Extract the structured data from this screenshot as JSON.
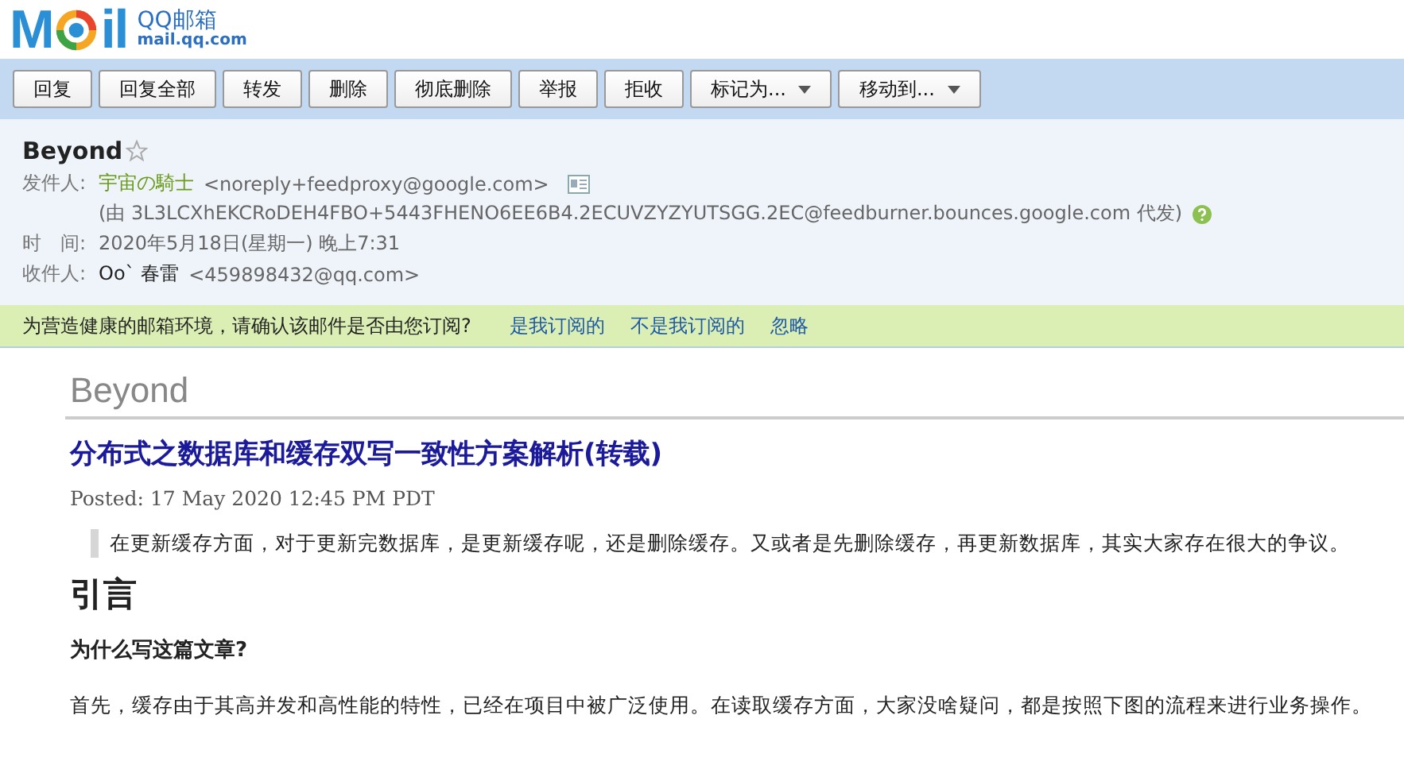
{
  "logo": {
    "left": "M",
    "right": "il",
    "product": "QQ邮箱",
    "domain": "mail.qq.com"
  },
  "toolbar": [
    {
      "label": "回复",
      "kind": "plain"
    },
    {
      "label": "回复全部",
      "kind": "plain"
    },
    {
      "label": "转发",
      "kind": "plain"
    },
    {
      "label": "删除",
      "kind": "plain"
    },
    {
      "label": "彻底删除",
      "kind": "plain"
    },
    {
      "label": "举报",
      "kind": "plain"
    },
    {
      "label": "拒收",
      "kind": "plain"
    },
    {
      "label": "标记为...",
      "kind": "dropdown"
    },
    {
      "label": "移动到...",
      "kind": "dropdown"
    }
  ],
  "mail": {
    "subject": "Beyond",
    "starred": false,
    "from_label": "发件人:",
    "from_name": "宇宙の騎士",
    "from_address": "<noreply+feedproxy@google.com>",
    "via": "(由 3L3LCXhEKCRoDEH4FBO+5443FHENO6EE6B4.2ECUVZYZYUTSGG.2EC@feedburner.bounces.google.com 代发)",
    "time_label": "时　间:",
    "time": "2020年5月18日(星期一) 晚上7:31",
    "to_label": "收件人:",
    "to_name": "Oo`  春雷",
    "to_address": "<459898432@qq.com>"
  },
  "notice": {
    "text": "为营造健康的邮箱环境，请确认该邮件是否由您订阅?",
    "links": [
      "是我订阅的",
      "不是我订阅的",
      "忽略"
    ]
  },
  "body": {
    "feed_title": "Beyond",
    "article_title": "分布式之数据库和缓存双写一致性方案解析(转载)",
    "posted": "Posted: 17 May 2020 12:45 PM PDT",
    "quote": "在更新缓存方面，对于更新完数据库，是更新缓存呢，还是删除缓存。又或者是先删除缓存，再更新数据库，其实大家存在很大的争议。",
    "heading": "引言",
    "subheading": "为什么写这篇文章?",
    "paragraph": "首先，缓存由于其高并发和高性能的特性，已经在项目中被广泛使用。在读取缓存方面，大家没啥疑问，都是按照下图的流程来进行业务操作。"
  }
}
